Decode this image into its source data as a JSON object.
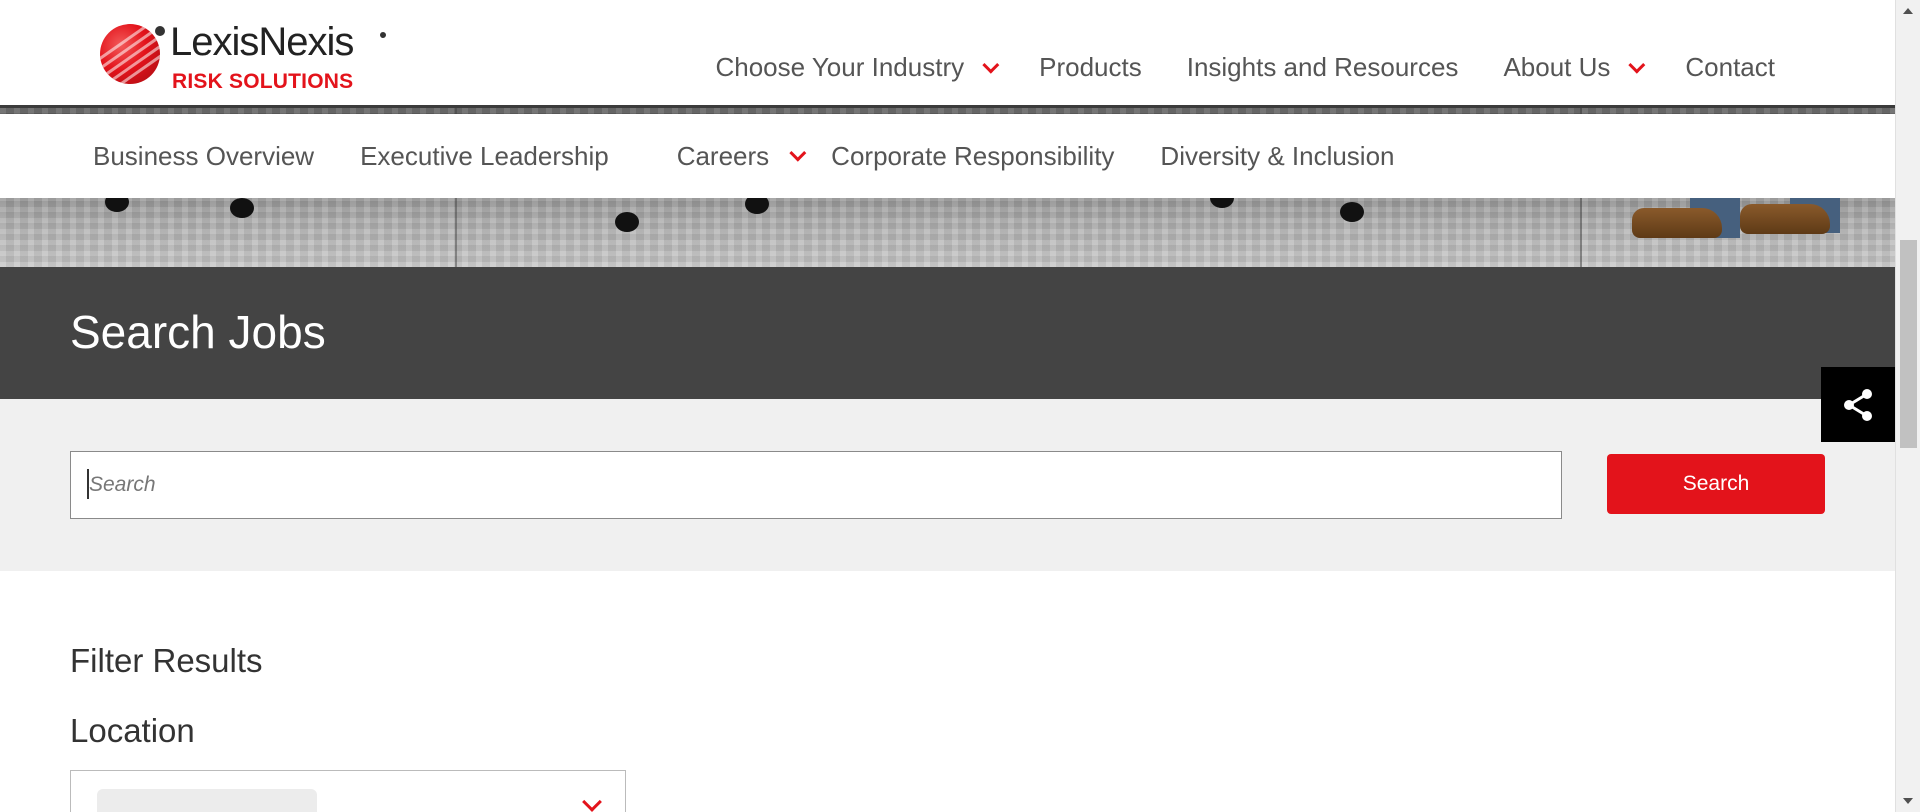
{
  "header": {
    "logo": {
      "name": "LexisNexis",
      "subtitle": "RISK SOLUTIONS"
    },
    "nav": [
      {
        "label": "Choose Your Industry",
        "has_dropdown": true
      },
      {
        "label": "Products",
        "has_dropdown": false
      },
      {
        "label": "Insights and Resources",
        "has_dropdown": false
      },
      {
        "label": "About Us",
        "has_dropdown": true
      },
      {
        "label": "Contact",
        "has_dropdown": false
      }
    ]
  },
  "sub_nav": [
    {
      "label": "Business Overview",
      "has_dropdown": false
    },
    {
      "label": "Executive Leadership",
      "has_dropdown": false
    },
    {
      "label": "Careers",
      "has_dropdown": true
    },
    {
      "label": "Corporate Responsibility",
      "has_dropdown": false
    },
    {
      "label": "Diversity & Inclusion",
      "has_dropdown": false
    }
  ],
  "banner": {
    "title": "Search Jobs"
  },
  "search": {
    "placeholder": "Search",
    "value": "",
    "button_label": "Search"
  },
  "filters": {
    "title": "Filter Results",
    "location_label": "Location"
  },
  "share": {
    "icon": "share-icon"
  },
  "colors": {
    "accent": "#e3131b",
    "banner_bg": "#444444",
    "search_area_bg": "#f0f0f0"
  }
}
